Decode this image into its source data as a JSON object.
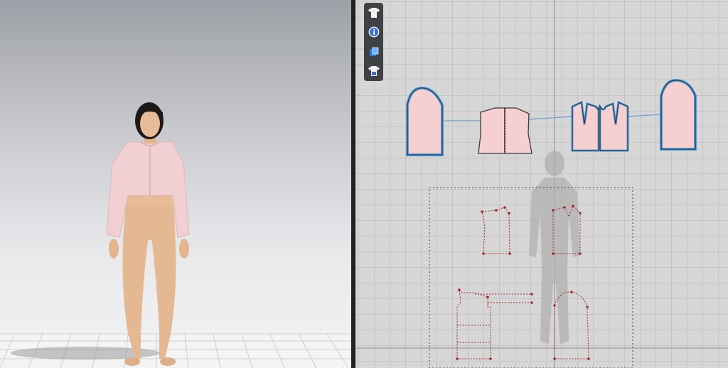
{
  "toolbar": {
    "tools": [
      {
        "name": "garment-tool",
        "icon": "tshirt-icon"
      },
      {
        "name": "info-tool",
        "icon": "info-icon"
      },
      {
        "name": "fabric-tool",
        "icon": "fabric-swatch-icon"
      },
      {
        "name": "avatar-garment-tool",
        "icon": "tshirt-avatar-icon"
      }
    ]
  },
  "colors": {
    "pattern_fill": "#f6cfd1",
    "pattern_outline": "#3a3a3a",
    "selected_outline": "#4ea0e6",
    "seam_line": "#7aa7d6",
    "draft_dots": "#9e2a2a",
    "grid": "#c5c5c5",
    "canvas_bg": "#d6d6d6"
  }
}
